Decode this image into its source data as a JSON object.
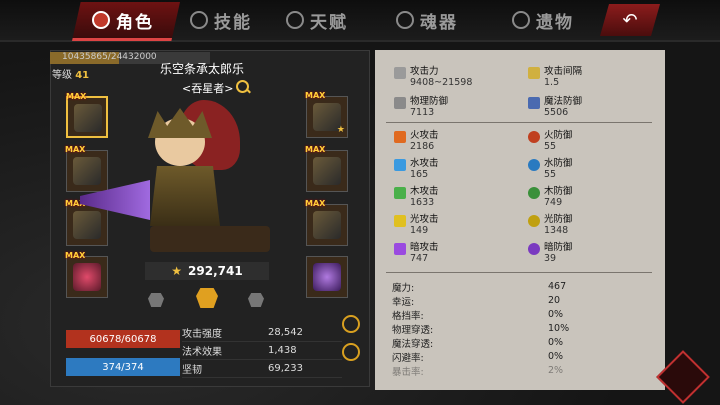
{
  "tabs": [
    {
      "label": "角色",
      "active": true
    },
    {
      "label": "技能",
      "active": false
    },
    {
      "label": "天赋",
      "active": false
    },
    {
      "label": "魂器",
      "active": false
    },
    {
      "label": "遗物",
      "active": false
    }
  ],
  "character": {
    "exp_text": "10435865/24432000",
    "exp_fraction": 0.43,
    "level_label": "等级",
    "level_value": "41",
    "name": "乐空条承太郎乐",
    "title": "<吞星者>",
    "power": "292,741",
    "hp": "60678/60678",
    "mp": "374/374"
  },
  "equipment_max_label": "MAX",
  "mini_stats": [
    {
      "key": "攻击强度",
      "value": "28,542"
    },
    {
      "key": "法术效果",
      "value": "1,438"
    },
    {
      "key": "坚韧",
      "value": "69,233"
    }
  ],
  "stats": {
    "attack": {
      "key": "攻击力",
      "value": "9408~21598"
    },
    "attack_interval": {
      "key": "攻击间隔",
      "value": "1.5"
    },
    "phys_def": {
      "key": "物理防御",
      "value": "7113"
    },
    "magic_def": {
      "key": "魔法防御",
      "value": "5506"
    },
    "fire_atk": {
      "key": "火攻击",
      "value": "2186"
    },
    "fire_def": {
      "key": "火防御",
      "value": "55"
    },
    "water_atk": {
      "key": "水攻击",
      "value": "165"
    },
    "water_def": {
      "key": "水防御",
      "value": "55"
    },
    "wood_atk": {
      "key": "木攻击",
      "value": "1633"
    },
    "wood_def": {
      "key": "木防御",
      "value": "749"
    },
    "light_atk": {
      "key": "光攻击",
      "value": "149"
    },
    "light_def": {
      "key": "光防御",
      "value": "1348"
    },
    "dark_atk": {
      "key": "暗攻击",
      "value": "747"
    },
    "dark_def": {
      "key": "暗防御",
      "value": "39"
    }
  },
  "extra_stats": [
    {
      "key": "魔力:",
      "value": "467"
    },
    {
      "key": "幸运:",
      "value": "20"
    },
    {
      "key": "格挡率:",
      "value": "0%"
    },
    {
      "key": "物理穿透:",
      "value": "10%"
    },
    {
      "key": "魔法穿透:",
      "value": "0%"
    },
    {
      "key": "闪避率:",
      "value": "0%"
    },
    {
      "key": "暴击率:",
      "value": "2%"
    }
  ],
  "colors": {
    "accent_red": "#c0392b",
    "gold": "#f0c040",
    "hp": "#b2321e",
    "mp": "#2d7ac0",
    "panel": "#c9c4bc"
  }
}
